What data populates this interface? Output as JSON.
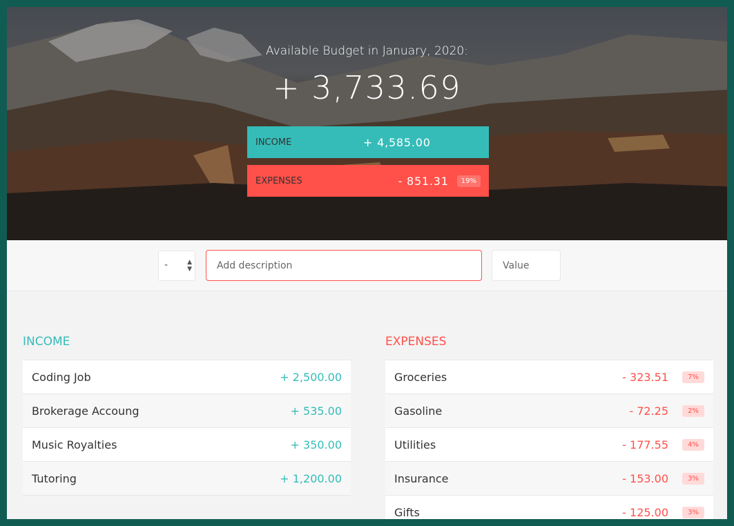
{
  "header": {
    "budget_title": "Available Budget in January, 2020:",
    "budget_value": "+ 3,733.69"
  },
  "summary": {
    "income_label": "Income",
    "income_value": "+ 4,585.00",
    "expenses_label": "Expenses",
    "expenses_value": "- 851.31",
    "expenses_percentage": "19%"
  },
  "add_form": {
    "type_value": "-",
    "description_placeholder": "Add description",
    "value_placeholder": "Value"
  },
  "income": {
    "title": "Income",
    "items": [
      {
        "description": "Coding Job",
        "value": "+ 2,500.00"
      },
      {
        "description": "Brokerage Accoung",
        "value": "+ 535.00"
      },
      {
        "description": "Music Royalties",
        "value": "+ 350.00"
      },
      {
        "description": "Tutoring",
        "value": "+ 1,200.00"
      }
    ]
  },
  "expenses": {
    "title": "Expenses",
    "items": [
      {
        "description": "Groceries",
        "value": "- 323.51",
        "percentage": "7%"
      },
      {
        "description": "Gasoline",
        "value": "- 72.25",
        "percentage": "2%"
      },
      {
        "description": "Utilities",
        "value": "- 177.55",
        "percentage": "4%"
      },
      {
        "description": "Insurance",
        "value": "- 153.00",
        "percentage": "3%"
      },
      {
        "description": "Gifts",
        "value": "- 125.00",
        "percentage": "3%"
      }
    ]
  },
  "colors": {
    "income_accent": "#35bcb8",
    "expenses_accent": "#ff5049",
    "page_border": "#115c52"
  }
}
